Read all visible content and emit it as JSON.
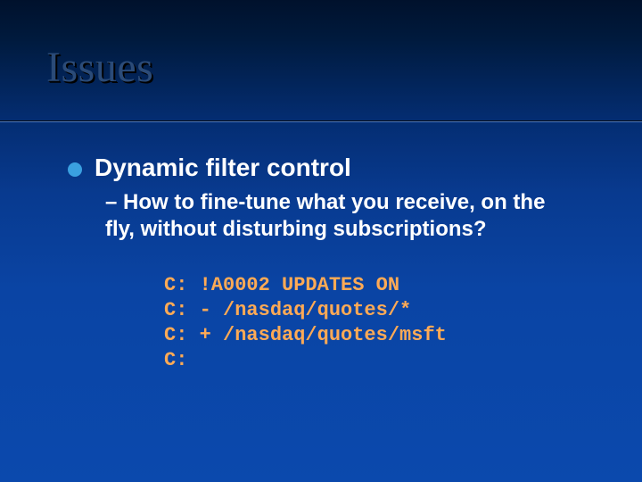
{
  "title": "Issues",
  "bullet": "Dynamic filter control",
  "sub_dash": "–",
  "sub_text": "How to fine-tune what you receive, on the fly, without disturbing subscriptions?",
  "code": {
    "l1": "C: !A0002 UPDATES ON",
    "l2": "C: - /nasdaq/quotes/*",
    "l3": "C: + /nasdaq/quotes/msft",
    "l4": "C:"
  }
}
